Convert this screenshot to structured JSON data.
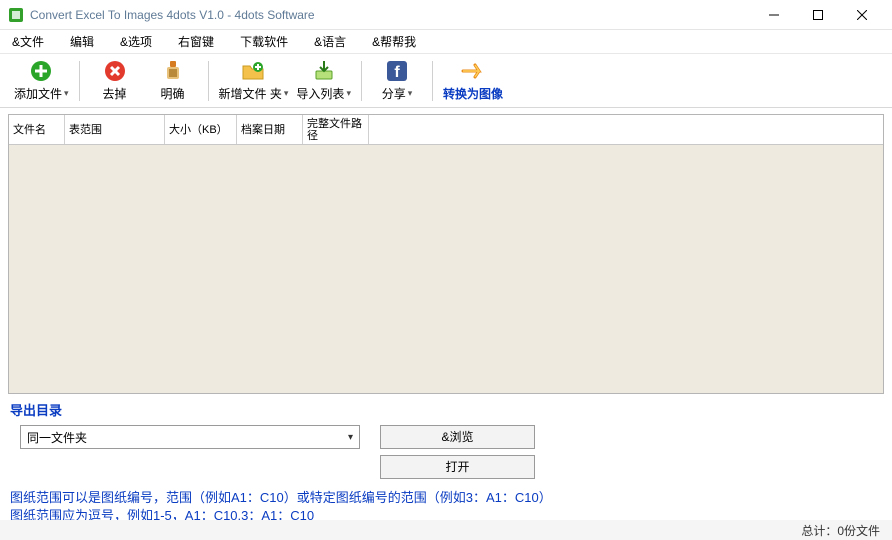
{
  "window": {
    "title": "Convert Excel To Images 4dots V1.0 - 4dots Software"
  },
  "menu": {
    "file": "&文件",
    "edit": "编辑",
    "options": "&选项",
    "shortcuts": "右窗键",
    "download": "下载软件",
    "language": "&语言",
    "help": "&帮帮我"
  },
  "toolbar": {
    "add_file": "添加文件",
    "remove": "去掉",
    "clear": "明确",
    "new_folder": "新增文件 夹",
    "import_list": "导入列表",
    "share": "分享",
    "convert": "转换为图像"
  },
  "columns": {
    "filename": "文件名",
    "sheet_range": "表范围",
    "size_kb": "大小（KB）",
    "file_date": "档案日期",
    "full_path": "完整文件路径"
  },
  "output": {
    "section_label": "导出目录",
    "same_folder": "同一文件夹",
    "browse": "&浏览",
    "open": "打开"
  },
  "hints": {
    "line1": "图纸范围可以是图纸编号，范围（例如A1：C10）或特定图纸编号的范围（例如3：A1：C10）",
    "line2": "图纸范围应为逗号，例如1-5，A1：C10,3：A1：C10"
  },
  "status": {
    "total": "总计：0份文件"
  }
}
